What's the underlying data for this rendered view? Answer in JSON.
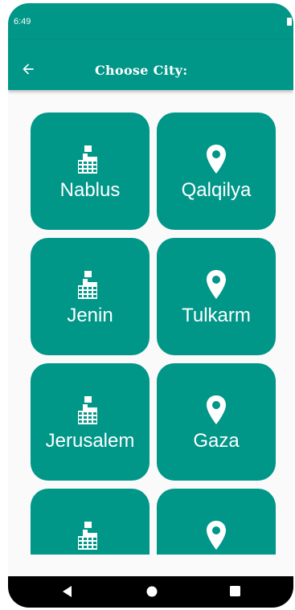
{
  "status": {
    "time": "6:49"
  },
  "appbar": {
    "title": "Choose City:"
  },
  "cities": [
    {
      "name": "Nablus",
      "icon": "building-icon"
    },
    {
      "name": "Qalqilya",
      "icon": "location-pin-icon"
    },
    {
      "name": "Jenin",
      "icon": "building-icon"
    },
    {
      "name": "Tulkarm",
      "icon": "location-pin-icon"
    },
    {
      "name": "Jerusalem",
      "icon": "building-icon"
    },
    {
      "name": "Gaza",
      "icon": "location-pin-icon"
    },
    {
      "name": "",
      "icon": "building-icon"
    },
    {
      "name": "",
      "icon": "location-pin-icon"
    }
  ],
  "navbar": {
    "items": [
      "back-nav-icon",
      "home-nav-icon",
      "recents-nav-icon"
    ]
  },
  "colors": {
    "primary": "#009688",
    "background": "#fafafa"
  }
}
